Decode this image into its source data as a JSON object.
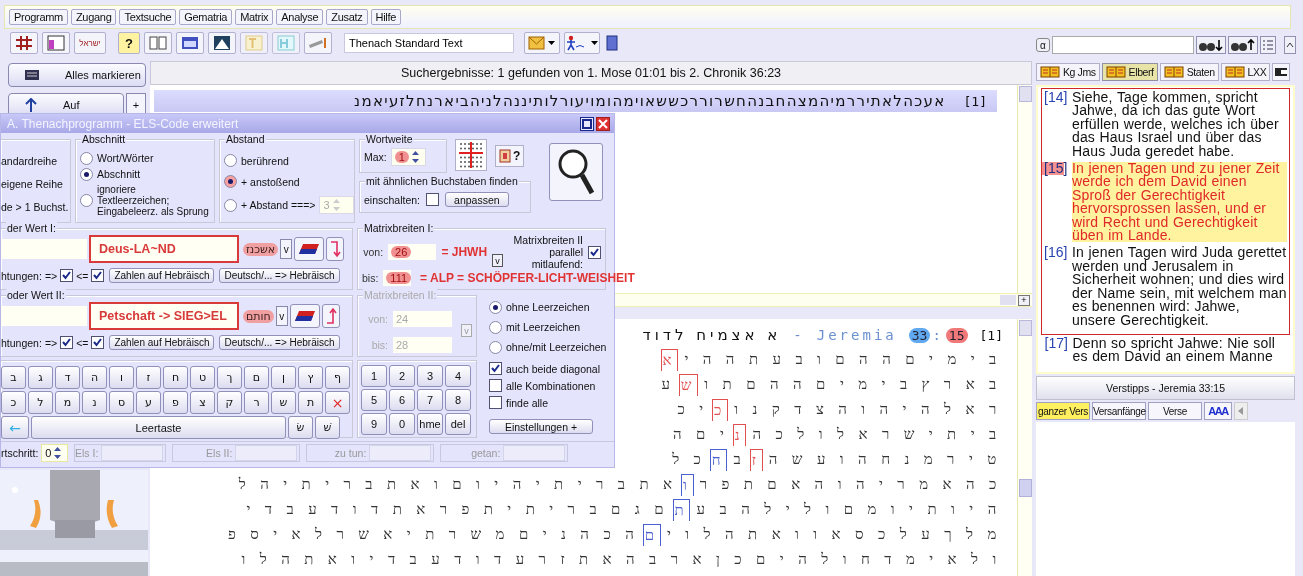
{
  "menu": [
    {
      "label": "Programm"
    },
    {
      "label": "Zugang"
    },
    {
      "label": "Textsuche"
    },
    {
      "label": "Gematria"
    },
    {
      "label": "Matrix"
    },
    {
      "label": "Analyse"
    },
    {
      "label": "Zusatz"
    },
    {
      "label": "Hilfe"
    }
  ],
  "toolbar": {
    "hebrew_button": "ישראל",
    "help_button": "?",
    "text_source": "Thenach Standard Text"
  },
  "left": {
    "select_all": "Alles markieren",
    "up": "Auf",
    "plus": "+"
  },
  "results": {
    "header": "Suchergebnisse: 1 gefunden von 1. Mose 01:01 bis 2. Chronik 36:23",
    "line_number": "[1]",
    "line_text": "אעכהלאתיררמיהמצהחבנהחשרוררכששאוימהומויעורלותיננהלניהביארנחלזעיאמנ",
    "splitter_plus": "+"
  },
  "grid": {
    "hebrew": "א אצמיח לדוד",
    "separator": "-",
    "book": "Jeremia",
    "chapter": "33",
    "colon": ":",
    "verse": "15",
    "line_number": "[1]",
    "rows": [
      {
        "segments": [
          {
            "text": "ב י מ י ם ה ה ם ו ב ע ת ה ה י"
          },
          {
            "text": "א",
            "color": "#e05050"
          }
        ]
      },
      {
        "segments": [
          {
            "text": "ב א ר ץ ב י מ י ם ה ה ם ת ו"
          },
          {
            "text": "ש",
            "color": "#e05050"
          },
          {
            "text": "ע"
          }
        ]
      },
      {
        "segments": [
          {
            "text": "ר א ל ה י ה ו ה צ ד ק נ ו"
          },
          {
            "text": "כ",
            "color": "#e05050"
          },
          {
            "text": "י כ"
          }
        ]
      },
      {
        "segments": [
          {
            "text": "ב י ת י ש ר א ל ו ל כ ה"
          },
          {
            "text": "נ",
            "color": "#e05050"
          },
          {
            "text": "י ם ה"
          }
        ]
      },
      {
        "segments": [
          {
            "text": "ט י ר מ נ ח ה ו ע ש ה"
          },
          {
            "text": "ז",
            "color": "#e05050"
          },
          {
            "text": "ב"
          },
          {
            "text": "ח",
            "color": "#4a5fd0"
          },
          {
            "text": "כ ל"
          }
        ]
      },
      {
        "segments": [
          {
            "text": "כ ה א מ ר י ה ו ה א ם ת פ ר"
          },
          {
            "text": "ו",
            "color": "#4a5fd0"
          },
          {
            "text": "א ת ב ר י ת י ה י ו ם ו א ת ב ר י ת י ה ל"
          }
        ]
      },
      {
        "segments": [
          {
            "text": "ה י ו ת י ו מ ם ו ל י ל ה ב ע"
          },
          {
            "text": "ת",
            "color": "#4a5fd0"
          },
          {
            "text": "ם ג ם ב ר י ת י ת פ ר א ת ד ו ד ע ב ד י"
          }
        ]
      },
      {
        "segments": [
          {
            "text": "מ ל ך ע ל כ ס א ו ו א ת ה ל ו י"
          },
          {
            "text": "ם",
            "color": "#4a5fd0"
          },
          {
            "text": "ה כ ה נ י ם מ ש ר ת י א ש ר ל א י ס פ"
          }
        ]
      },
      {
        "segments": [
          {
            "text": "ו ל א י מ ד ח ו ל ה י ם כ ן א ר ב ה א ת ז ר ע ד ו ד ע ב ד י ו א ת ה ל ו"
          }
        ]
      }
    ]
  },
  "dialog": {
    "title": "A. Thenachprogramm - ELS-Code erweitert",
    "order_options": [
      "andardreihe",
      "eigene Reihe",
      "de > 1 Buchst."
    ],
    "section": {
      "title": "Abschnitt",
      "options": [
        {
          "label": "Wort/Wörter",
          "selected": false
        },
        {
          "label": "Abschnitt",
          "selected": true
        },
        {
          "label": "ignoriere Textleerzeichen; Eingabeleerz. als Sprung",
          "selected": false
        }
      ]
    },
    "distance": {
      "title": "Abstand",
      "options": [
        {
          "label": "berührend",
          "selected": false
        },
        {
          "label": "+ anstoßend",
          "selected": true
        },
        {
          "label": "+ Abstand ===>",
          "selected": false
        }
      ],
      "spin_value": "3"
    },
    "word_width": {
      "title": "Wortweite",
      "label": "Max:",
      "value": "1"
    },
    "similar": {
      "title": "mit ähnlichen Buchstaben finden",
      "label": "einschalten:",
      "checked": false,
      "button": "anpassen"
    },
    "help_button": "?",
    "values": [
      {
        "title": "der Wert I:",
        "note": "Deus-LA~ND",
        "hebrew": "אשכנז",
        "dropdown": "v",
        "directions_label": "htungen:",
        "forward": "=>",
        "forward_checked": true,
        "backward": "<=",
        "backward_checked": true,
        "buttons": [
          "Zahlen auf Hebräisch",
          "Deutsch/... => Hebräisch"
        ]
      },
      {
        "title": "oder Wert II:",
        "note": "Petschaft -> SIEG>EL",
        "hebrew": "חותם",
        "dropdown": "v",
        "directions_label": "htungen:",
        "forward": "=>",
        "forward_checked": true,
        "backward": "<=",
        "backward_checked": true,
        "buttons": [
          "Zahlen auf Hebräisch",
          "Deutsch/... => Hebräisch"
        ]
      }
    ],
    "matrix1": {
      "title": "Matrixbreiten I:",
      "from_label": "von:",
      "from": "26",
      "from_note": "= JHWH",
      "to_label": "bis:",
      "to": "111",
      "to_note": "= ALP = SCHÖPFER-LICHT-WEISHEIT",
      "parallel_label": "Matrixbreiten II parallel mitlaufend:",
      "parallel_checked": true,
      "link": "v"
    },
    "matrix2": {
      "title": "Matrixbreiten II:",
      "disabled": true,
      "from_label": "von:",
      "from": "24",
      "to_label": "bis:",
      "to": "28",
      "link": "v"
    },
    "spaces": [
      {
        "label": "ohne Leerzeichen",
        "selected": true
      },
      {
        "label": "mit Leerzeichen",
        "selected": false
      },
      {
        "label": "ohne/mit Leerzeichen",
        "selected": false
      }
    ],
    "keyboard": {
      "rows": [
        [
          "ב",
          "ג",
          "ד",
          "ה",
          "ו",
          "ז",
          "ח",
          "ט",
          "ך",
          "ם",
          "ן",
          "ץ",
          "ף"
        ],
        [
          "כ",
          "ל",
          "מ",
          "נ",
          "ס",
          "ע",
          "פ",
          "צ",
          "ק",
          "ר",
          "ש",
          "ת",
          "×"
        ]
      ],
      "back": "←",
      "space": "Leertaste",
      "extra": [
        "שׁ",
        "שׂ"
      ]
    },
    "numpad": [
      "1",
      "2",
      "3",
      "4",
      "5",
      "6",
      "7",
      "8",
      "9",
      "0",
      "hme",
      "del"
    ],
    "options": [
      {
        "label": "auch beide diagonal",
        "checked": true
      },
      {
        "label": "alle Kombinationen",
        "checked": false
      },
      {
        "label": "finde alle",
        "checked": false
      }
    ],
    "settings_button": "Einstellungen +",
    "status": [
      {
        "label": "rtschritt:",
        "value": "0",
        "kind": "spinner"
      },
      {
        "label": "Els I:",
        "kind": "field"
      },
      {
        "label": "Els II:",
        "kind": "field"
      },
      {
        "label": "zu tun:",
        "kind": "field"
      },
      {
        "label": "getan:",
        "kind": "field"
      }
    ]
  },
  "right": {
    "alpha_button": "α",
    "tabs": [
      {
        "label": "Kg Jms",
        "selected": false
      },
      {
        "label": "Elberf",
        "selected": true
      },
      {
        "label": "Staten",
        "selected": false
      },
      {
        "label": "LXX",
        "selected": false
      }
    ],
    "verses": [
      {
        "number": "[14]",
        "text": "Siehe, Tage kommen, spricht Jahwe, da ich das gute Wort erfüllen werde, welches ich über das Haus Israel und über das Haus Juda geredet habe.",
        "highlighted": false
      },
      {
        "number": "[15]",
        "text": "In jenen Tagen und zu jener Zeit werde ich dem David einen Sproß der Gerechtigkeit hervorsprossen lassen, und er wird Recht und Gerechtigkeit üben im Lande.",
        "highlighted": true
      },
      {
        "number": "[16]",
        "text": "In jenen Tagen wird Juda gerettet werden und Jerusalem in Sicherheit wohnen; und dies wird der Name sein, mit welchem man es benennen wird: Jahwe, unsere Gerechtigkeit.",
        "highlighted": false
      },
      {
        "number": "[17]",
        "text": "Denn so spricht Jahwe: Nie soll es dem David an einem Manne",
        "highlighted": false
      }
    ],
    "tips_title": "Verstipps - Jeremia 33:15",
    "tip_buttons": [
      {
        "label": "ganzer Vers",
        "selected": true
      },
      {
        "label": "Versanfänge",
        "selected": false
      },
      {
        "label": "Verse",
        "selected": false
      }
    ],
    "font_button": "AAA"
  }
}
